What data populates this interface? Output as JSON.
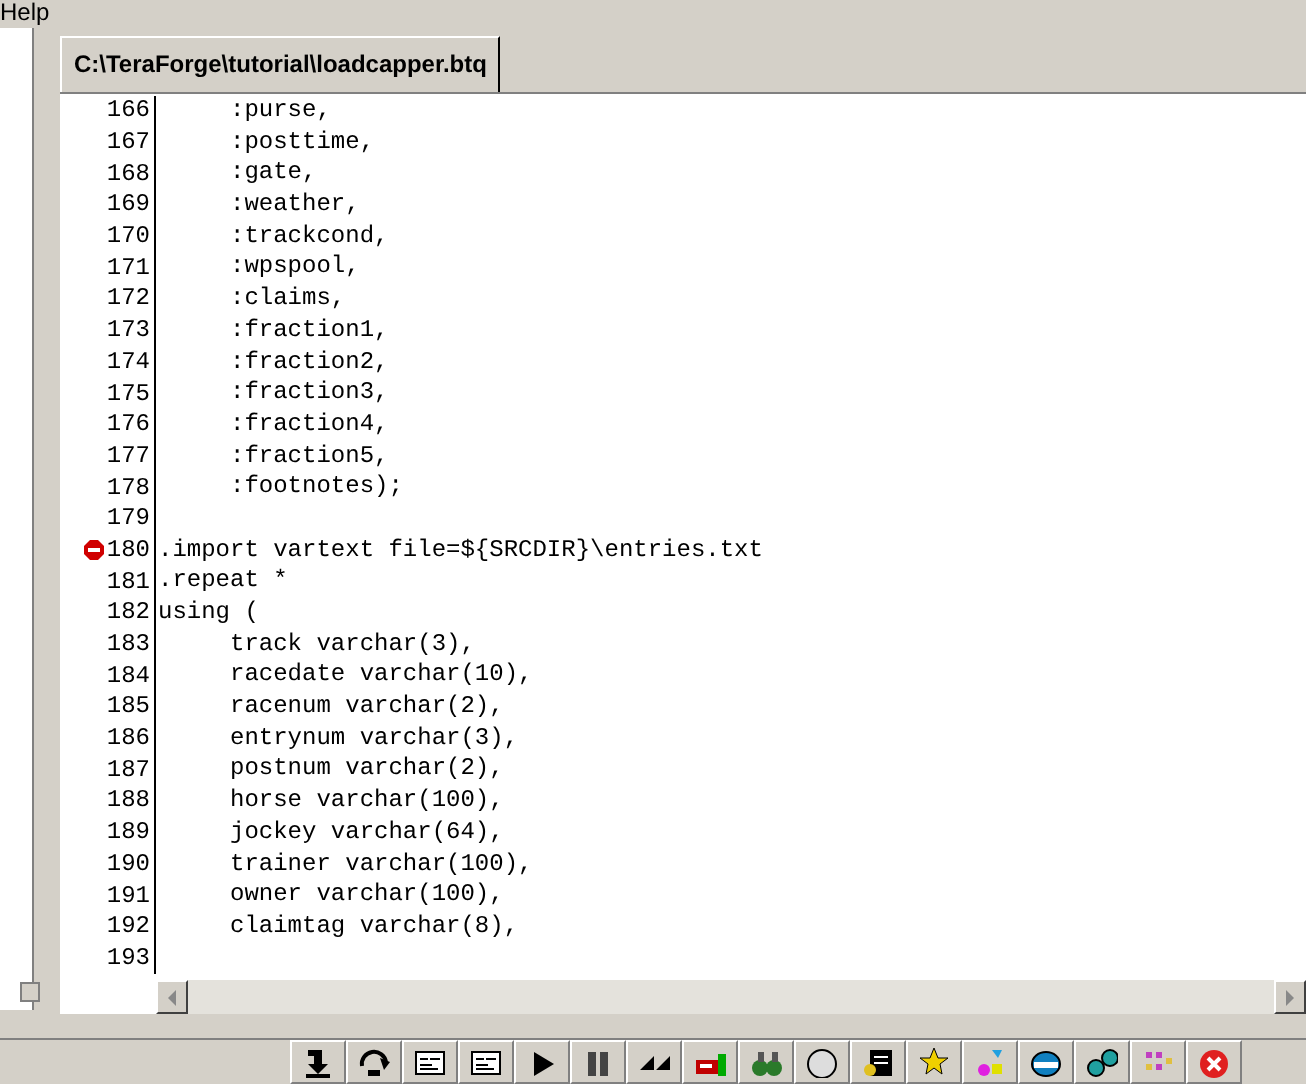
{
  "menu": [
    {
      "label": "Help"
    }
  ],
  "tabs": [
    {
      "label": "C:\\TeraForge\\tutorial\\loadcapper.btq",
      "selected": true
    }
  ],
  "editor": {
    "lines": [
      {
        "number": "166",
        "code": "     :purse,",
        "breakpoint": false
      },
      {
        "number": "167",
        "code": "     :posttime,",
        "breakpoint": false
      },
      {
        "number": "168",
        "code": "     :gate,",
        "breakpoint": false
      },
      {
        "number": "169",
        "code": "     :weather,",
        "breakpoint": false
      },
      {
        "number": "170",
        "code": "     :trackcond,",
        "breakpoint": false
      },
      {
        "number": "171",
        "code": "     :wpspool,",
        "breakpoint": false
      },
      {
        "number": "172",
        "code": "     :claims,",
        "breakpoint": false
      },
      {
        "number": "173",
        "code": "     :fraction1,",
        "breakpoint": false
      },
      {
        "number": "174",
        "code": "     :fraction2,",
        "breakpoint": false
      },
      {
        "number": "175",
        "code": "     :fraction3,",
        "breakpoint": false
      },
      {
        "number": "176",
        "code": "     :fraction4,",
        "breakpoint": false
      },
      {
        "number": "177",
        "code": "     :fraction5,",
        "breakpoint": false
      },
      {
        "number": "178",
        "code": "     :footnotes);",
        "breakpoint": false
      },
      {
        "number": "179",
        "breakpoint": false
      },
      {
        "number": "180",
        "code": ".import vartext file=${SRCDIR}\\entries.txt",
        "breakpoint": true
      },
      {
        "number": "181",
        "code": ".repeat *",
        "breakpoint": false
      },
      {
        "number": "182",
        "code": "using (",
        "breakpoint": false
      },
      {
        "number": "183",
        "code": "     track varchar(3),",
        "breakpoint": false
      },
      {
        "number": "184",
        "code": "     racedate varchar(10),",
        "breakpoint": false
      },
      {
        "number": "185",
        "code": "     racenum varchar(2),",
        "breakpoint": false
      },
      {
        "number": "186",
        "code": "     entrynum varchar(3),",
        "breakpoint": false
      },
      {
        "number": "187",
        "code": "     postnum varchar(2),",
        "breakpoint": false
      },
      {
        "number": "188",
        "code": "     horse varchar(100),",
        "breakpoint": false
      },
      {
        "number": "189",
        "code": "     jockey varchar(64),",
        "breakpoint": false
      },
      {
        "number": "190",
        "code": "     trainer varchar(100),",
        "breakpoint": false
      },
      {
        "number": "191",
        "code": "     owner varchar(100),",
        "breakpoint": false
      },
      {
        "number": "192",
        "code": "     claimtag varchar(8),",
        "breakpoint": false
      },
      {
        "number": "193",
        "breakpoint": false
      }
    ]
  },
  "toolbar": [
    {
      "kind": "step-into"
    },
    {
      "kind": "step-over"
    },
    {
      "kind": "list"
    },
    {
      "kind": "list"
    },
    {
      "kind": "play"
    },
    {
      "kind": "pause"
    },
    {
      "kind": "fast-forward"
    },
    {
      "kind": "tag"
    },
    {
      "kind": "binoculars"
    },
    {
      "kind": "circle"
    },
    {
      "kind": "document"
    },
    {
      "kind": "star"
    },
    {
      "kind": "shapes"
    },
    {
      "kind": "disk"
    },
    {
      "kind": "gears"
    },
    {
      "kind": "grid"
    },
    {
      "kind": "close"
    }
  ]
}
